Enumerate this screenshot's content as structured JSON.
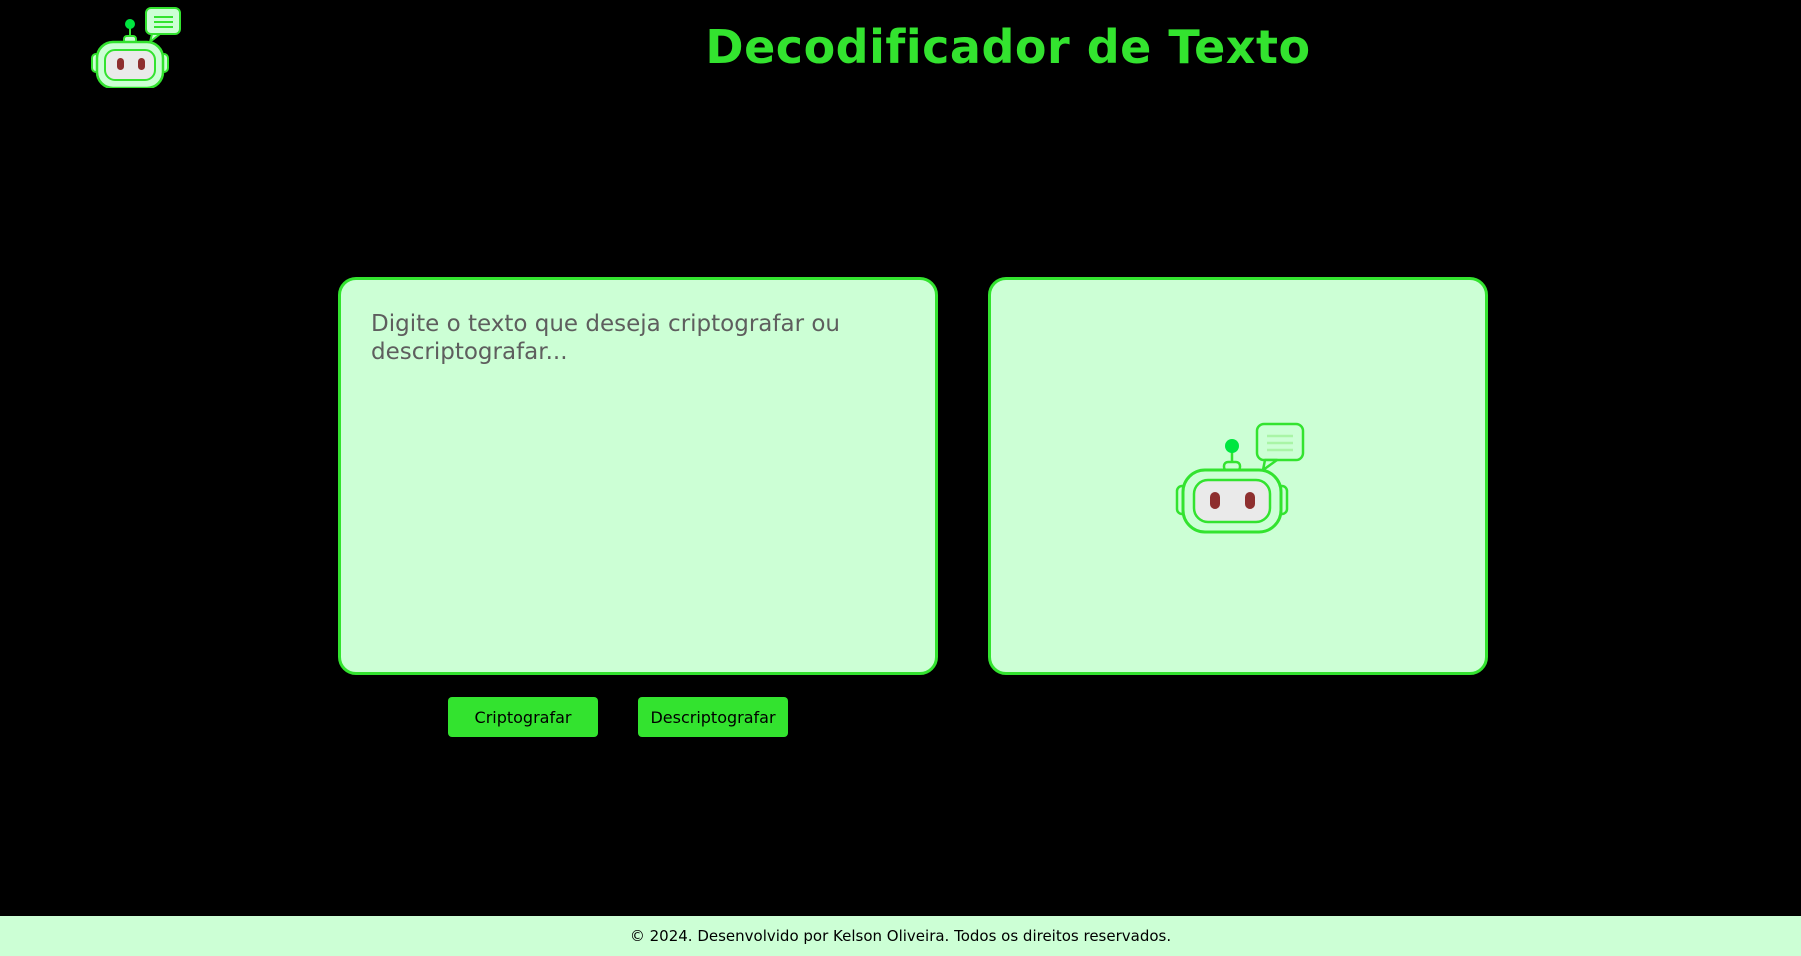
{
  "header": {
    "logo_icon": "robot-chat-icon",
    "title": "Decodificador de Texto"
  },
  "input": {
    "placeholder": "Digite o texto que deseja criptografar ou descriptografar...",
    "value": ""
  },
  "output": {
    "illustration_icon": "robot-chat-icon",
    "text": ""
  },
  "actions": {
    "encrypt_label": "Criptografar",
    "decrypt_label": "Descriptografar"
  },
  "footer": {
    "text": "© 2024. Desenvolvido por Kelson Oliveira. Todos os direitos reservados."
  },
  "colors": {
    "background": "#000000",
    "accent": "#33e32f",
    "panel": "#ccffd5",
    "robot_eyes": "#8e2f2f"
  }
}
